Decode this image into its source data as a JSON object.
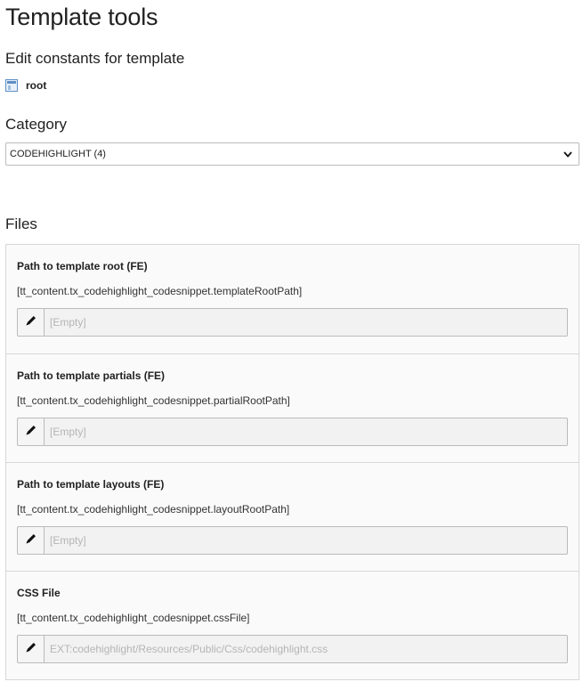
{
  "header": {
    "title": "Template tools",
    "subtitle": "Edit constants for template",
    "record_label": "root"
  },
  "category": {
    "heading": "Category",
    "selected": "CODEHIGHLIGHT (4)"
  },
  "files": {
    "heading": "Files",
    "items": [
      {
        "label": "Path to template root (FE)",
        "key": "[tt_content.tx_codehighlight_codesnippet.templateRootPath]",
        "placeholder": "[Empty]"
      },
      {
        "label": "Path to template partials (FE)",
        "key": "[tt_content.tx_codehighlight_codesnippet.partialRootPath]",
        "placeholder": "[Empty]"
      },
      {
        "label": "Path to template layouts (FE)",
        "key": "[tt_content.tx_codehighlight_codesnippet.layoutRootPath]",
        "placeholder": "[Empty]"
      },
      {
        "label": "CSS File",
        "key": "[tt_content.tx_codehighlight_codesnippet.cssFile]",
        "placeholder": "EXT:codehighlight/Resources/Public/Css/codehighlight.css"
      }
    ]
  },
  "icons": {
    "record": "page-icon",
    "edit": "pencil-icon",
    "select_toggle": "chevron-down-icon"
  }
}
